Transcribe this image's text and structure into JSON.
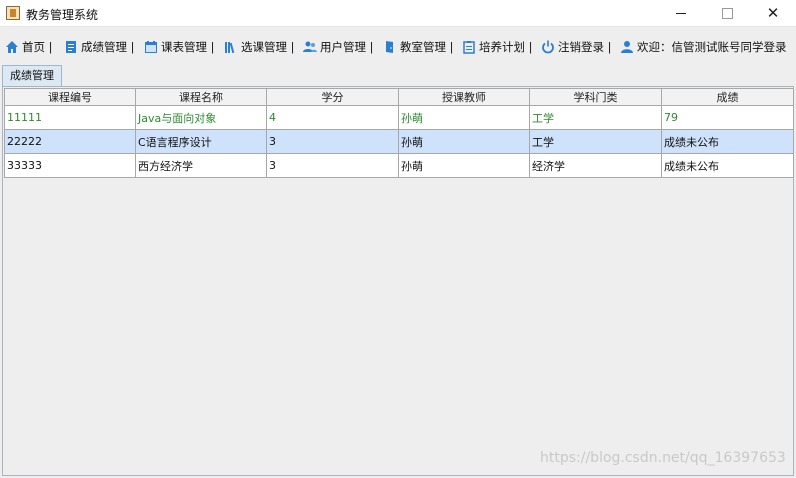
{
  "window": {
    "title": "教务管理系统",
    "minimize": "",
    "maximize": "",
    "close": "✕"
  },
  "toolbar": {
    "items": [
      {
        "label": "首页 |",
        "icon": "home-icon"
      },
      {
        "label": "成绩管理 |",
        "icon": "document-icon"
      },
      {
        "label": "课表管理 |",
        "icon": "calendar-icon"
      },
      {
        "label": "选课管理 |",
        "icon": "books-icon"
      },
      {
        "label": "用户管理 |",
        "icon": "users-icon"
      },
      {
        "label": "教室管理 |",
        "icon": "door-icon"
      },
      {
        "label": "培养计划 |",
        "icon": "clipboard-icon"
      },
      {
        "label": "注销登录 |",
        "icon": "power-icon"
      },
      {
        "label": "欢迎：信管测试账号同学登录",
        "icon": "user-icon"
      }
    ]
  },
  "tabs": [
    {
      "label": "成绩管理"
    }
  ],
  "table": {
    "columns": [
      "课程编号",
      "课程名称",
      "学分",
      "授课教师",
      "学科门类",
      "成绩"
    ],
    "rows": [
      [
        "11111",
        "Java与面向对象",
        "4",
        "孙萌",
        "工学",
        "79"
      ],
      [
        "22222",
        "C语言程序设计",
        "3",
        "孙萌",
        "工学",
        "成绩未公布"
      ],
      [
        "33333",
        "西方经济学",
        "3",
        "孙萌",
        "经济学",
        "成绩未公布"
      ]
    ]
  },
  "watermark": "https://blog.csdn.net/qq_16397653",
  "colors": {
    "highlight_text": "#2e8b2e",
    "selected_row": "#cfe2fb",
    "icon_blue": "#2b7fd0"
  }
}
